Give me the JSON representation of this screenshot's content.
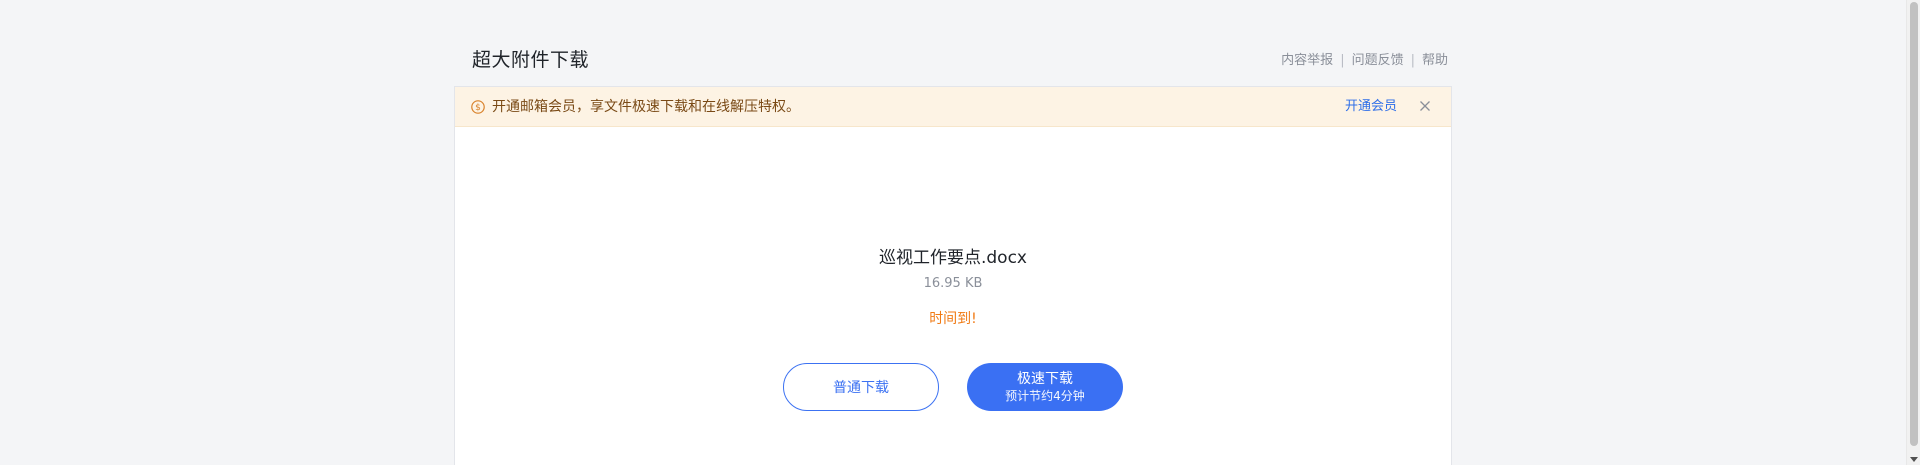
{
  "header": {
    "title": "超大附件下载",
    "links": [
      "内容举报",
      "问题反馈",
      "帮助"
    ],
    "separator": "|"
  },
  "banner": {
    "icon": "coin-icon",
    "text": "开通邮箱会员，享文件极速下载和在线解压特权。",
    "action_label": "开通会员",
    "close_icon": "close-icon",
    "background_color": "#fdf3e4",
    "text_color": "#7a4a16"
  },
  "file": {
    "name": "巡视工作要点.docx",
    "size": "16.95 KB",
    "status": "时间到!",
    "status_color": "#f07a14"
  },
  "buttons": {
    "normal_download": "普通下载",
    "fast_download": "极速下载",
    "fast_download_note": "预计节约4分钟",
    "accent_color": "#3a70f3"
  }
}
